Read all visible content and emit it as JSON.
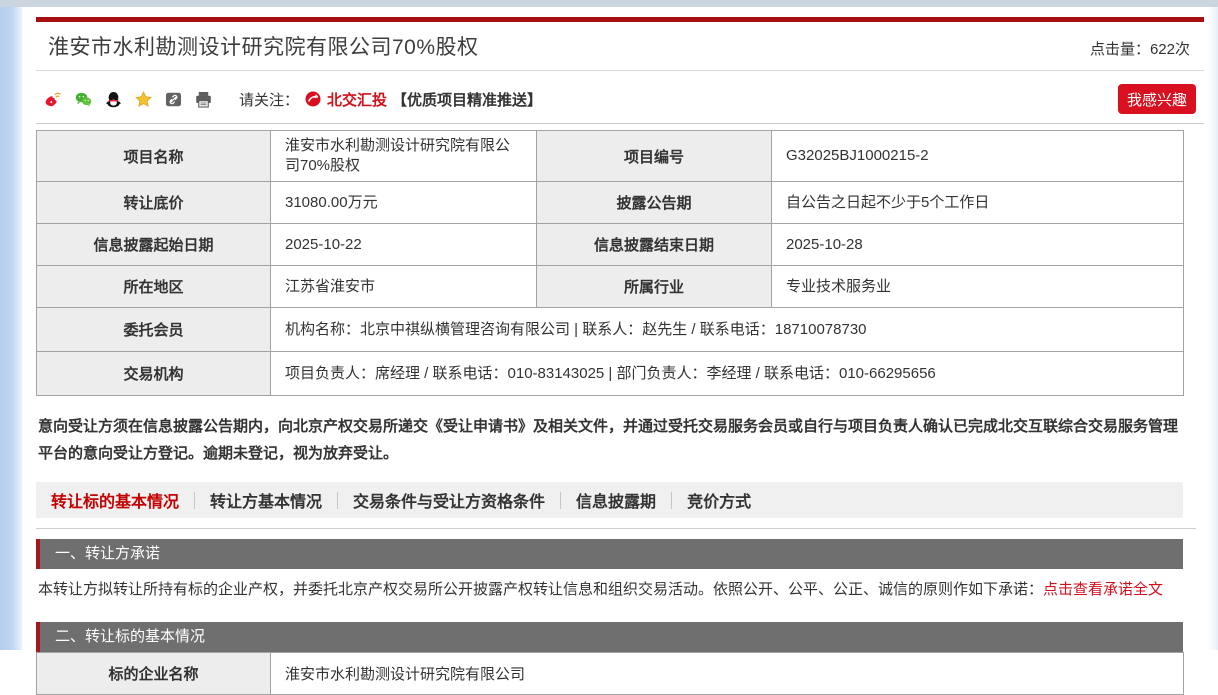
{
  "header": {
    "title": "淮安市水利勘测设计研究院有限公司70%股权",
    "hits_label": "点击量：",
    "hits_value": "622次"
  },
  "share": {
    "icons": [
      "weibo",
      "wechat",
      "qq",
      "favorite-star",
      "copy-link",
      "print"
    ],
    "follow_label": "请关注：",
    "follow_brand": "北交汇投",
    "follow_note": "【优质项目精准推送】",
    "interest_button": "我感兴趣"
  },
  "info_table": {
    "r0": {
      "l1": "项目名称",
      "v1": "淮安市水利勘测设计研究院有限公司70%股权",
      "l2": "项目编号",
      "v2": "G32025BJ1000215-2"
    },
    "r1": {
      "l1": "转让底价",
      "v1": "31080.00万元",
      "l2": "披露公告期",
      "v2": "自公告之日起不少于5个工作日"
    },
    "r2": {
      "l1": "信息披露起始日期",
      "v1": "2025-10-22",
      "l2": "信息披露结束日期",
      "v2": "2025-10-28"
    },
    "r3": {
      "l1": "所在地区",
      "v1": "江苏省淮安市",
      "l2": "所属行业",
      "v2": "专业技术服务业"
    },
    "r4": {
      "l": "委托会员",
      "v": "机构名称：北京中祺纵横管理咨询有限公司 | 联系人：赵先生 / 联系电话：18710078730"
    },
    "r5": {
      "l": "交易机构",
      "v": "项目负责人：席经理 / 联系电话：010-83143025 | 部门负责人：李经理 / 联系电话：010-66295656"
    }
  },
  "notice": "意向受让方须在信息披露公告期内，向北京产权交易所递交《受让申请书》及相关文件，并通过受托交易服务会员或自行与项目负责人确认已完成北交互联综合交易服务管理平台的意向受让方登记。逾期未登记，视为放弃受让。",
  "tabs": [
    {
      "label": "转让标的基本情况",
      "active": true
    },
    {
      "label": "转让方基本情况",
      "active": false
    },
    {
      "label": "交易条件与受让方资格条件",
      "active": false
    },
    {
      "label": "信息披露期",
      "active": false
    },
    {
      "label": "竞价方式",
      "active": false
    }
  ],
  "section1": {
    "heading": "一、转让方承诺",
    "body": "本转让方拟转让所持有标的企业产权，并委托北京产权交易所公开披露产权转让信息和组织交易活动。依照公开、公平、公正、诚信的原则作如下承诺：",
    "link": "点击查看承诺全文"
  },
  "section2": {
    "heading": "二、转让标的基本情况"
  },
  "target_table": {
    "label": "标的企业名称",
    "value": "淮安市水利勘测设计研究院有限公司"
  },
  "colors": {
    "top_bar_red": "#a50e13",
    "button_red": "#d8101f",
    "link_red": "#d30f1e",
    "active_tab_red": "#c40000",
    "section_header_gray": "#6f6f6f",
    "section_border_red": "#a6161d",
    "brand_red": "#d0121b"
  }
}
